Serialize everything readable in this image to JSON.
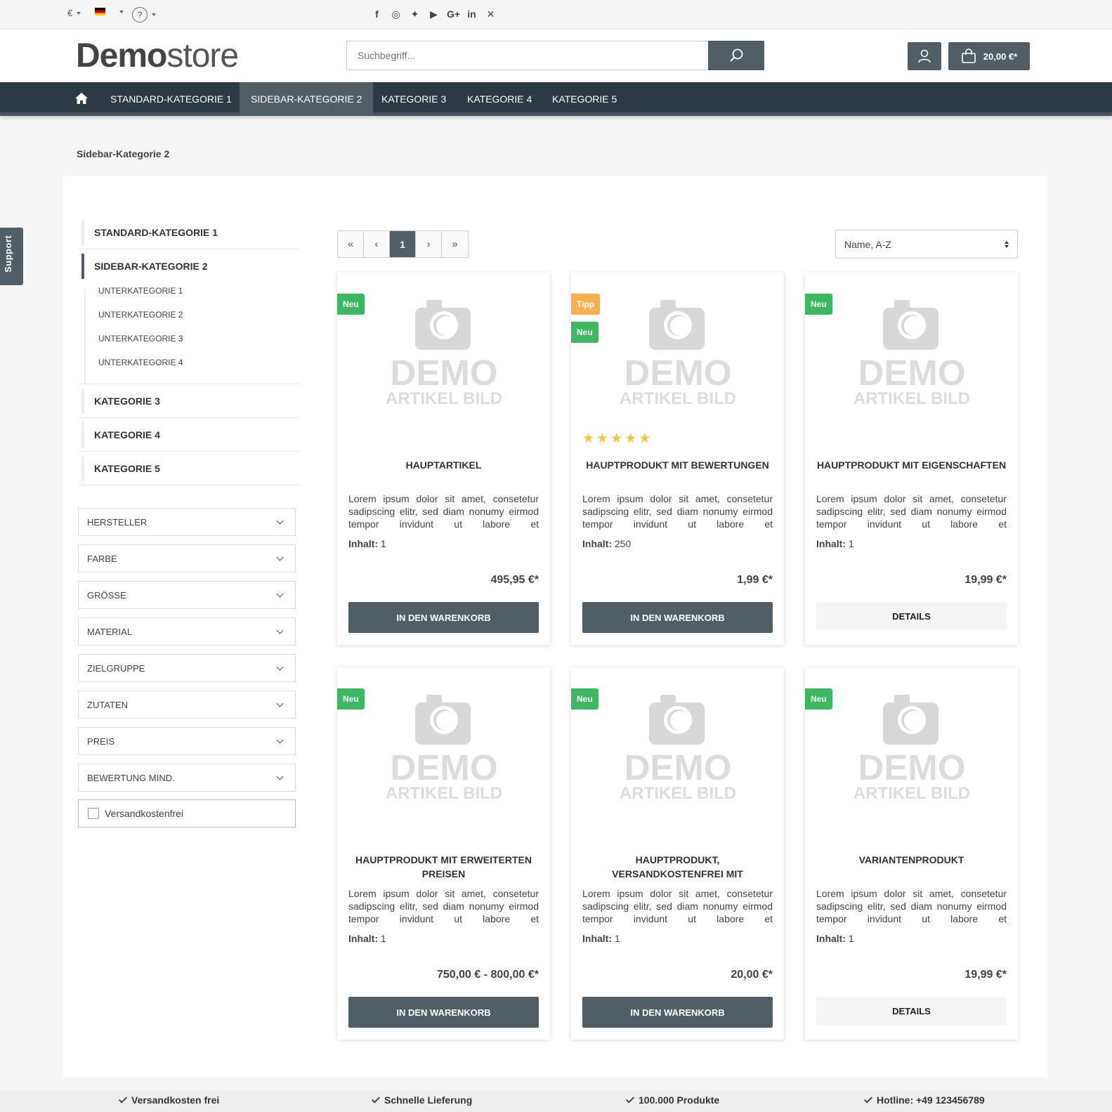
{
  "topbar": {
    "currency": "€",
    "social_icons": [
      "facebook-icon",
      "instagram-icon",
      "twitter-icon",
      "youtube-icon",
      "google-plus-icon",
      "linkedin-icon",
      "xing-icon"
    ]
  },
  "header": {
    "logo_bold": "Demo",
    "logo_light": "store",
    "search_placeholder": "Suchbegriff...",
    "cart_total": "20,00 €*"
  },
  "nav": {
    "items": [
      {
        "label": "Standard-Kategorie 1"
      },
      {
        "label": "Sidebar-Kategorie 2",
        "active": true
      },
      {
        "label": "Kategorie 3"
      },
      {
        "label": "Kategorie 4"
      },
      {
        "label": "Kategorie 5"
      }
    ]
  },
  "breadcrumb": "Sidebar-Kategorie 2",
  "sidebar": {
    "categories": [
      "STANDARD-KATEGORIE 1",
      "SIDEBAR-KATEGORIE 2",
      "KATEGORIE 3",
      "KATEGORIE 4",
      "KATEGORIE 5"
    ],
    "subcategories": [
      "UNTERKATEGORIE 1",
      "UNTERKATEGORIE 2",
      "UNTERKATEGORIE 3",
      "UNTERKATEGORIE 4"
    ],
    "filters": [
      "HERSTELLER",
      "FARBE",
      "GRÖSSE",
      "MATERIAL",
      "ZIELGRUPPE",
      "ZUTATEN",
      "PREIS",
      "BEWERTUNG MIND."
    ],
    "shipping_free_label": "Versandkostenfrei"
  },
  "listing": {
    "current_page": "1",
    "sort_value": "Name, A-Z",
    "products": [
      {
        "badges": [
          "Neu"
        ],
        "title": "HAUPTARTIKEL",
        "desc": "Lorem ipsum dolor sit amet, consetetur sadipscing elitr, sed diam nonumy eirmod tempor invidunt ut labore et",
        "inhalt_label": "Inhalt:",
        "inhalt": "1",
        "price": "495,95 €*",
        "button": "IN DEN WARENKORB",
        "button_style": "dark"
      },
      {
        "badges": [
          "Tipp",
          "Neu"
        ],
        "rating": 5,
        "title": "HAUPTPRODUKT MIT BEWERTUNGEN",
        "desc": "Lorem ipsum dolor sit amet, consetetur sadipscing elitr, sed diam nonumy eirmod tempor invidunt ut labore et",
        "inhalt_label": "Inhalt:",
        "inhalt": "250",
        "price": "1,99 €*",
        "button": "IN DEN WARENKORB",
        "button_style": "dark"
      },
      {
        "badges": [
          "Neu"
        ],
        "title": "HAUPTPRODUKT MIT EIGENSCHAFTEN",
        "desc": "Lorem ipsum dolor sit amet, consetetur sadipscing elitr, sed diam nonumy eirmod tempor invidunt ut labore et",
        "inhalt_label": "Inhalt:",
        "inhalt": "1",
        "price": "19,99 €*",
        "button": "DETAILS",
        "button_style": "light"
      },
      {
        "badges": [
          "Neu"
        ],
        "title": "HAUPTPRODUKT MIT ERWEITERTEN PREISEN",
        "desc": "Lorem ipsum dolor sit amet, consetetur sadipscing elitr, sed diam nonumy eirmod tempor invidunt ut labore et",
        "inhalt_label": "Inhalt:",
        "inhalt": "1",
        "price": "750,00 € - 800,00 €*",
        "button": "IN DEN WARENKORB",
        "button_style": "dark"
      },
      {
        "badges": [
          "Neu"
        ],
        "title": "HAUPTPRODUKT, VERSANDKOSTENFREI MIT",
        "desc": "Lorem ipsum dolor sit amet, consetetur sadipscing elitr, sed diam nonumy eirmod tempor invidunt ut labore et",
        "inhalt_label": "Inhalt:",
        "inhalt": "1",
        "price": "20,00 €*",
        "button": "IN DEN WARENKORB",
        "button_style": "dark"
      },
      {
        "badges": [
          "Neu"
        ],
        "title": "VARIANTENPRODUKT",
        "desc": "Lorem ipsum dolor sit amet, consetetur sadipscing elitr, sed diam nonumy eirmod tempor invidunt ut labore et",
        "inhalt_label": "Inhalt:",
        "inhalt": "1",
        "price": "19,99 €*",
        "button": "DETAILS",
        "button_style": "light"
      }
    ],
    "placeholder_line1": "DEMO",
    "placeholder_line2": "ARTIKEL BILD"
  },
  "support_label": "Support",
  "footer": {
    "usps": [
      "Versandkosten frei",
      "Schnelle Lieferung",
      "100.000 Produkte",
      "Hotline: +49 123456789"
    ]
  },
  "colors": {
    "primary": "#525e66",
    "nav_bg": "#2b3a43",
    "badge_new": "#3cb960",
    "badge_tip": "#f8b04f",
    "star": "#f5c542"
  }
}
